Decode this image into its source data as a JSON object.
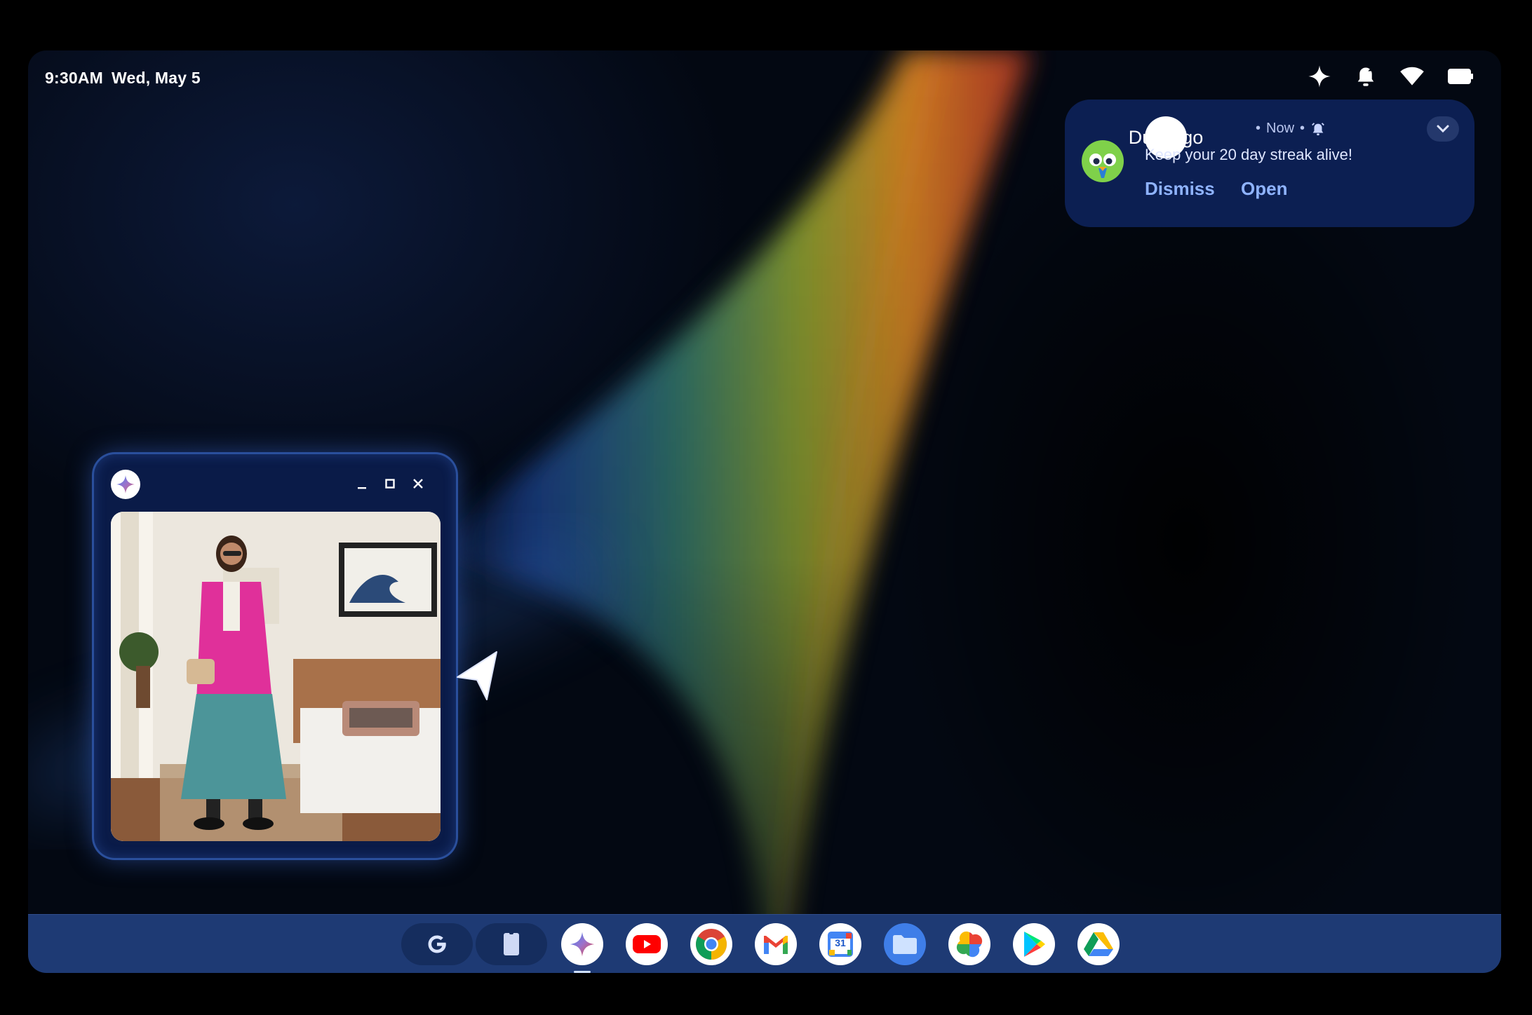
{
  "status_bar": {
    "time": "9:30AM",
    "date": "Wed, May 5",
    "icons": [
      "sparkle-icon",
      "notifications-paused-icon",
      "wifi-icon",
      "battery-icon"
    ]
  },
  "notification": {
    "app_name": "Duolingo",
    "time": "Now",
    "message": "Keep your 20 day streak alive!",
    "dismiss_label": "Dismiss",
    "open_label": "Open",
    "icons": [
      "duolingo-owl-icon",
      "alarm-icon",
      "chevron-down-icon"
    ]
  },
  "floating_window": {
    "app_icon": "gemini-icon",
    "controls": [
      "minimize-icon",
      "maximize-icon",
      "close-icon"
    ]
  },
  "taskbar": {
    "pinned": [
      "google-search-icon",
      "tablet-icon"
    ],
    "apps": [
      "gemini",
      "youtube",
      "chrome",
      "gmail",
      "calendar",
      "files",
      "photos",
      "play-store",
      "drive"
    ],
    "calendar_day": "31",
    "active_app": "gemini"
  },
  "colors": {
    "notification_bg": "#0c1f52",
    "taskbar_bg": "#1e3a74",
    "accent": "#8fb3ff"
  }
}
